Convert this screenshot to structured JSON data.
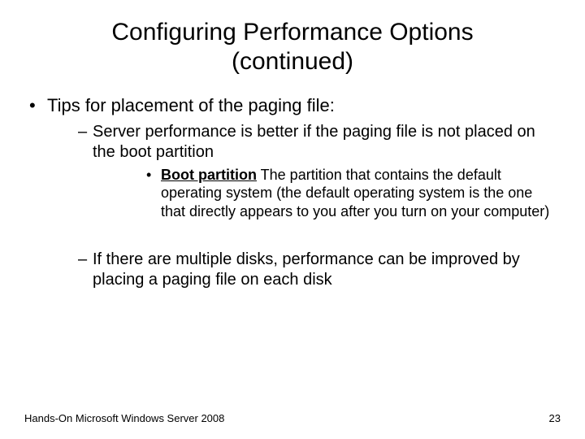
{
  "title_line1": "Configuring Performance Options",
  "title_line2": "(continued)",
  "bullets": {
    "l1_0": "Tips for placement of the paging file:",
    "l2_0": "Server performance is better if the paging file is not placed on the boot partition",
    "l3_0_term": "Boot partition",
    "l3_0_rest": " The partition that contains the default operating system (the default operating system is the one that directly appears to you after you turn on your computer)",
    "l2_1": "If there are multiple disks, performance can be improved by placing a paging file on each disk"
  },
  "footer": {
    "left": "Hands-On Microsoft Windows Server 2008",
    "right": "23"
  }
}
